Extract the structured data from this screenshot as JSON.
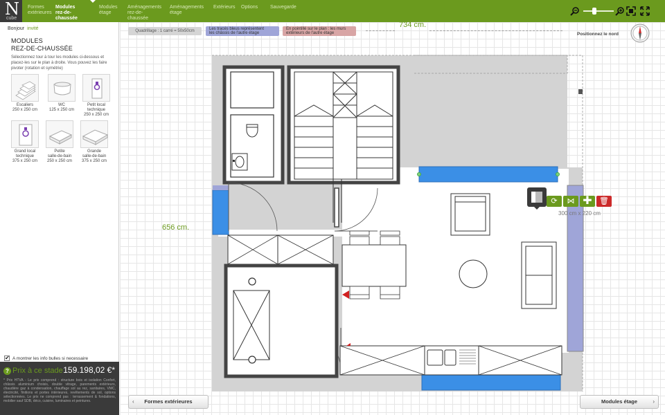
{
  "logo": {
    "letter": "N",
    "sub": "cube"
  },
  "nav": [
    {
      "label": "Formes\nextérieures",
      "active": false
    },
    {
      "label": "Modules\nrez-de-chaussée",
      "active": true
    },
    {
      "label": "Modules\nétage",
      "active": false
    },
    {
      "label": "Aménagements\nrez-de-chaussée",
      "active": false
    },
    {
      "label": "Aménagements\nétage",
      "active": false
    },
    {
      "label": "Extérieurs",
      "active": false
    },
    {
      "label": "Options",
      "active": false
    },
    {
      "label": "Sauvegarde",
      "active": false
    }
  ],
  "toolbar": {
    "zoom_out_icon": "zoom-out-icon",
    "zoom_in_icon": "zoom-in-icon",
    "zoom_level": 0.4
  },
  "sidebar": {
    "greeting": "Bonjour",
    "user": "invité",
    "title": "MODULES\nREZ-DE-CHAUSSÉE",
    "description": "Sélectionnez tour à tour les modules ci-dessous et placez-les sur le plan à droite. Vous pouvez les faire pivoter (rotation et symétrie)",
    "modules": [
      {
        "label": "Escaliers",
        "dim": "250 x 250 cm"
      },
      {
        "label": "WC",
        "dim": "125 x 250 cm"
      },
      {
        "label": "Petit local\ntechnique",
        "dim": "250 x 250 cm"
      },
      {
        "label": "Grand local\ntechnique",
        "dim": "375 x 250 cm"
      },
      {
        "label": "Petite\nsalle-de-bain",
        "dim": "250 x 250 cm"
      },
      {
        "label": "Grande\nsalle-de-bain",
        "dim": "375 x 250 cm"
      }
    ],
    "tips_label": "A montrer les info bulles si necessaire",
    "tips_checked": true
  },
  "price": {
    "label": "Prix à ce stade",
    "value": "159.198,02 €*",
    "note": "* Prix HTVA - Le prix comprend : structure bois et isolation Confort, châssis aluminium choisis, double vitrage, parements extérieurs, chaudière gaz à condensation, chauffage sol au rez, sanitaires, VMC, électricité, finitions et portes intérieures, revêtements de sol, options sélectionnées. Le prix ne comprend pas : terrassement & fondations, mobilier sauf SDB, déco, cuisine, luminaires et peintures."
  },
  "canvas": {
    "legend_grid": "Quadrillage : 1 carré = 50x50cm",
    "legend_blue": "Les tracés bleus représentent\nles châssis de l'autre étage",
    "legend_red": "En pointillé sur le plan : les murs\nextérieurs de l'autre étage",
    "dim_width": "734 cm.",
    "dim_height": "656 cm.",
    "north_label": "Positionnez le nord",
    "selected_dim": "300 cm x 220 cm"
  },
  "buttons": {
    "prev": "Formes extérieures",
    "next": "Modules étage"
  },
  "colors": {
    "brand_green": "#6b9a1e",
    "window_blue": "#3b8fe6",
    "delete_red": "#cc2a2a",
    "dark": "#3a3a3a"
  }
}
